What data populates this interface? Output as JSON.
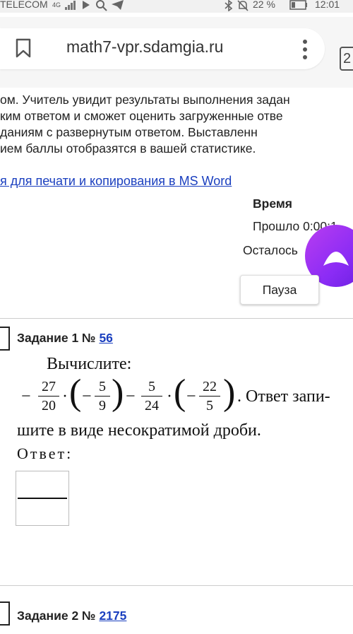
{
  "statusbar": {
    "carrier": "TELECOM",
    "network": "4G",
    "battery": "22 %",
    "time": "12:01"
  },
  "browser": {
    "url": "math7-vpr.sdamgia.ru",
    "tabs_count": "2"
  },
  "intro": {
    "lines": [
      "ом. Учитель увидит результаты выполнения задан",
      "ким ответом и сможет оценить загруженные отве",
      "даниям   с   развернутым   ответом.   Выставленн",
      "ием баллы отобразятся в вашей статистике."
    ],
    "print_link": "я для печати и копирования в MS Word"
  },
  "timer": {
    "title": "Время",
    "elapsed": "Прошло 0:00:1",
    "remaining": "Осталось",
    "pause_label": "Пауза"
  },
  "task1": {
    "title_prefix": "Задание 1 №",
    "number": "56",
    "heading": "Вычислите:",
    "minus": "−",
    "dot": "·",
    "fractions": [
      {
        "num": "27",
        "den": "20"
      },
      {
        "num": "5",
        "den": "9"
      },
      {
        "num": "5",
        "den": "24"
      },
      {
        "num": "22",
        "den": "5"
      }
    ],
    "instruction_part1": ". Ответ запи-",
    "instruction_part2": "шите в виде несократимой дроби.",
    "answer_label": "Ответ:"
  },
  "task2": {
    "title_prefix": "Задание 2 №",
    "number": "2175"
  },
  "colors": {
    "link": "#1a3fbf",
    "assistant": "#8b2cf5"
  }
}
